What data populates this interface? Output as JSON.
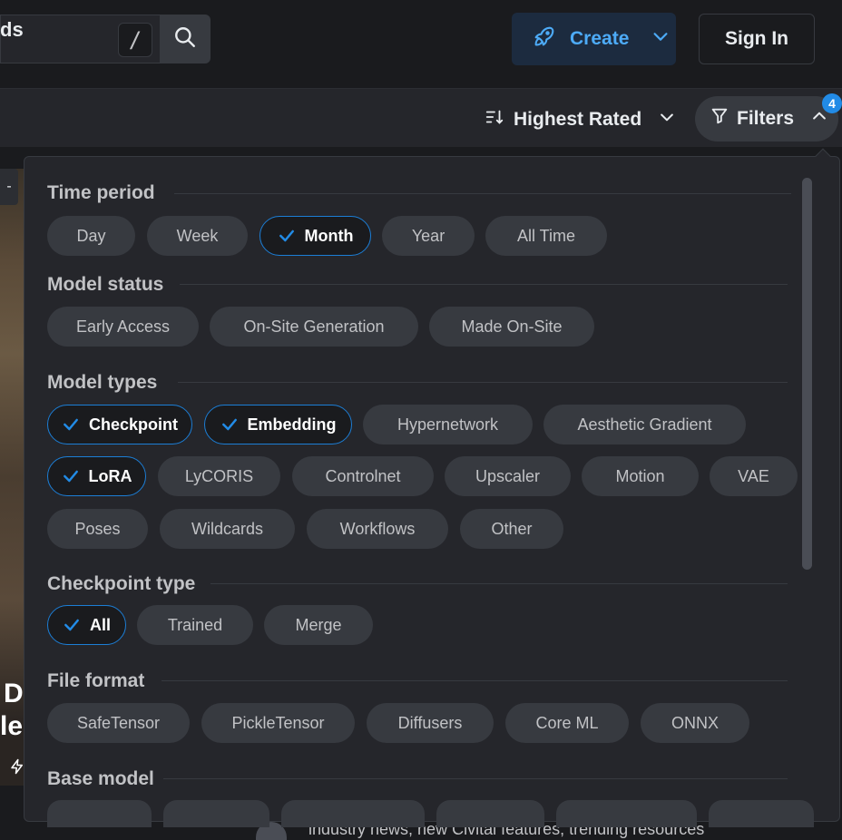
{
  "header": {
    "search_shortcut": "/",
    "create_label": "Create",
    "signin_label": "Sign In"
  },
  "subbar": {
    "left_text": "ds",
    "sort_label": "Highest Rated",
    "filters_label": "Filters",
    "filters_badge": "4"
  },
  "background": {
    "left_tab": "-",
    "left_text_1": "D",
    "left_text_2": "le",
    "bottom_text": "industry news, new Civitai features, trending resources"
  },
  "filters": {
    "time_period": {
      "title": "Time period",
      "options": [
        "Day",
        "Week",
        "Month",
        "Year",
        "All Time"
      ],
      "selected": [
        "Month"
      ]
    },
    "model_status": {
      "title": "Model status",
      "options": [
        "Early Access",
        "On-Site Generation",
        "Made On-Site"
      ],
      "selected": []
    },
    "model_types": {
      "title": "Model types",
      "options": [
        "Checkpoint",
        "Embedding",
        "Hypernetwork",
        "Aesthetic Gradient",
        "LoRA",
        "LyCORIS",
        "Controlnet",
        "Upscaler",
        "Motion",
        "VAE",
        "Poses",
        "Wildcards",
        "Workflows",
        "Other"
      ],
      "selected": [
        "Checkpoint",
        "Embedding",
        "LoRA"
      ]
    },
    "checkpoint_type": {
      "title": "Checkpoint type",
      "options": [
        "All",
        "Trained",
        "Merge"
      ],
      "selected": [
        "All"
      ]
    },
    "file_format": {
      "title": "File format",
      "options": [
        "SafeTensor",
        "PickleTensor",
        "Diffusers",
        "Core ML",
        "ONNX"
      ],
      "selected": []
    },
    "base_model": {
      "title": "Base model"
    }
  },
  "colors": {
    "accent": "#228be6",
    "accent_text": "#4dabf7",
    "chip_bg": "#373a40",
    "panel_bg": "#25262b",
    "page_bg": "#1a1b1e"
  },
  "icons": {
    "search": "search-icon",
    "create": "rocket-icon",
    "sort": "sort-descending-icon",
    "filter": "filter-icon",
    "check": "check-icon"
  }
}
